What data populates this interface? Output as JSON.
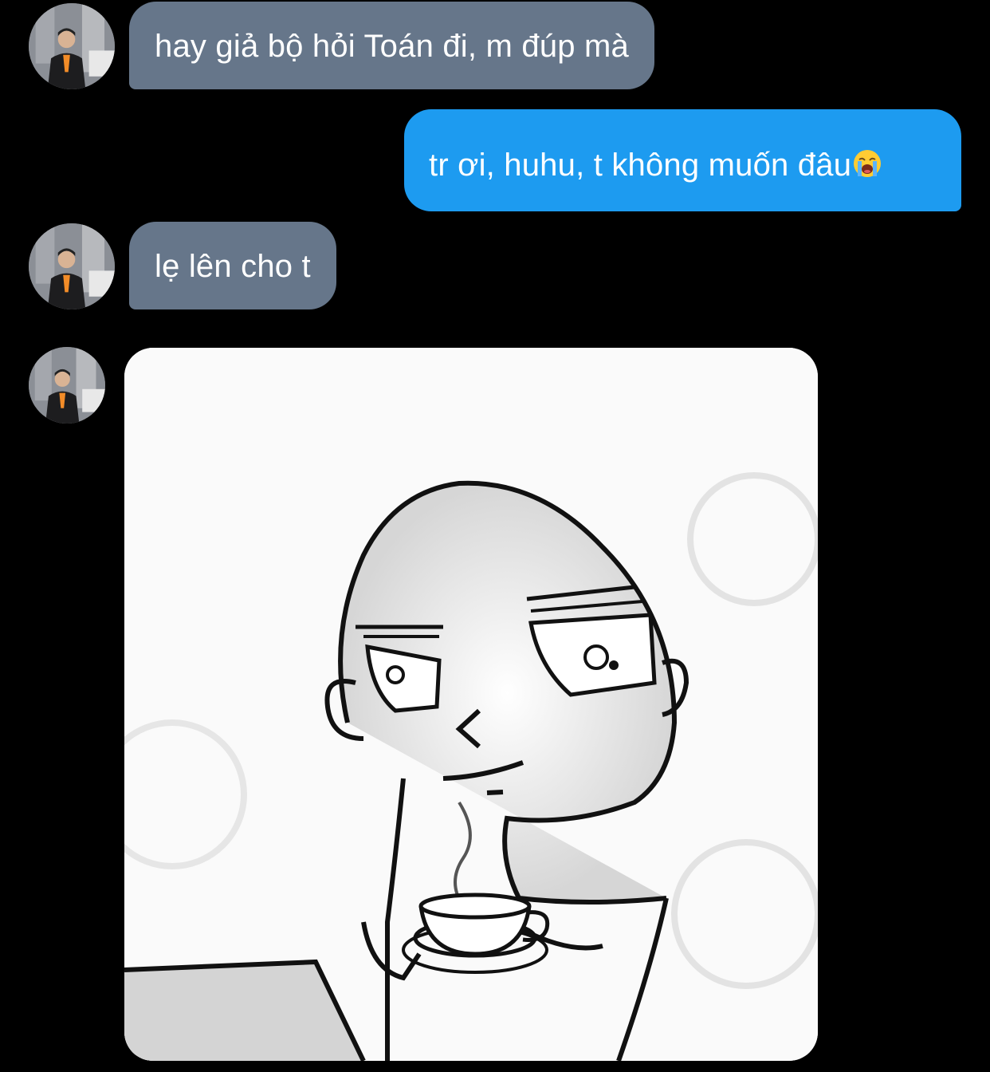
{
  "conversation": {
    "messages": [
      {
        "direction": "incoming",
        "text": "hay giả bộ hỏi Toán đi, m đúp mà"
      },
      {
        "direction": "outgoing",
        "text": "tr ơi, huhu, t không muốn đâu",
        "emoji": "loudly-crying-face"
      },
      {
        "direction": "incoming",
        "text": "lẹ lên cho t"
      },
      {
        "direction": "incoming",
        "type": "image",
        "image": "sketch-man-sipping-tea"
      }
    ]
  },
  "avatar": {
    "icon": "user-avatar-photo"
  },
  "colors": {
    "background": "#000000",
    "incoming_bubble": "#66768a",
    "outgoing_bubble": "#1d9bf0",
    "text": "#ffffff"
  }
}
